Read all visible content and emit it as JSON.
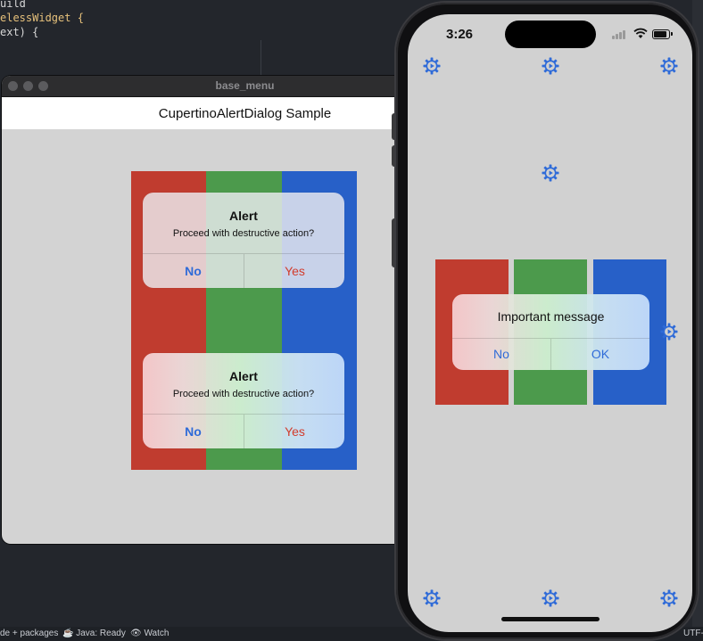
{
  "ide": {
    "code_lines": [
      {
        "text": "uild",
        "color": "#d7d7d7"
      },
      {
        "text": "elessWidget {",
        "color": "#e5c07b"
      },
      {
        "text": "ext) {",
        "color": "#d7d7d7"
      }
    ],
    "status_left": "de + packages",
    "status_java": "Java: Ready",
    "status_watch": "Watch",
    "status_encoding": "UTF-"
  },
  "desktop_window": {
    "title": "base_menu",
    "appbar_title": "CupertinoAlertDialog Sample",
    "stripe_colors": [
      "#c03c2f",
      "#4c9a4c",
      "#2760c8"
    ],
    "alerts": [
      {
        "title": "Alert",
        "message": "Proceed with destructive action?",
        "left_button": "No",
        "right_button": "Yes",
        "style": "plain"
      },
      {
        "title": "Alert",
        "message": "Proceed with destructive action?",
        "left_button": "No",
        "right_button": "Yes",
        "style": "gradient"
      }
    ]
  },
  "phone": {
    "time": "3:26",
    "battery_level": 0.85,
    "stripe_colors": [
      "#c03c2f",
      "#4c9a4c",
      "#2760c8"
    ],
    "alert": {
      "title": "Important message",
      "left_button": "No",
      "right_button": "OK"
    },
    "gear_icon": "gear-play-icon",
    "accent": "#2f6bd8"
  }
}
